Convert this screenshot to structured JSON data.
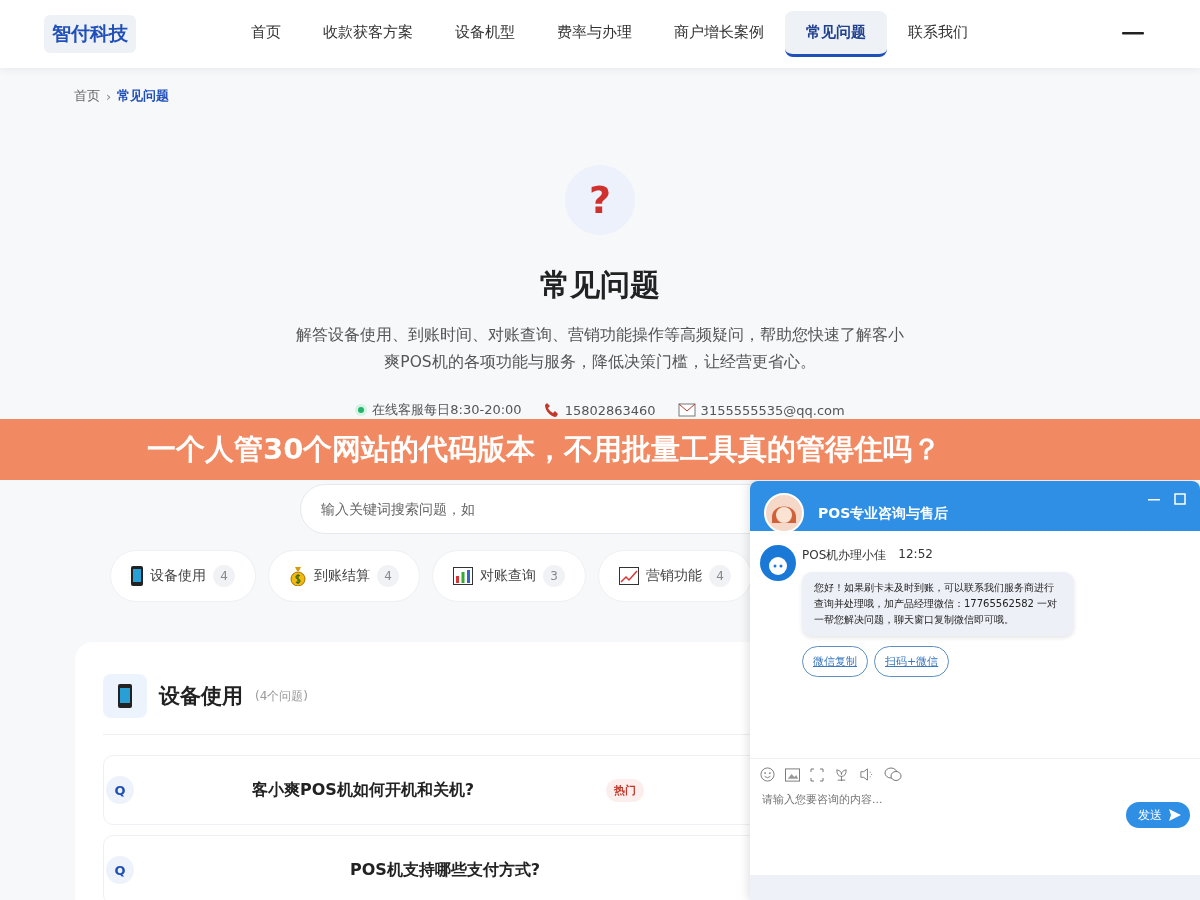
{
  "header": {
    "logo": "智付科技",
    "nav": [
      {
        "label": "首页",
        "selected": false
      },
      {
        "label": "收款获客方案",
        "selected": false
      },
      {
        "label": "设备机型",
        "selected": false
      },
      {
        "label": "费率与办理",
        "selected": false
      },
      {
        "label": "商户增长案例",
        "selected": false
      },
      {
        "label": "常见问题",
        "selected": true
      },
      {
        "label": "联系我们",
        "selected": false
      }
    ]
  },
  "breadcrumb_separator": "›",
  "breadcrumb": [
    {
      "label": "首页",
      "selected": false
    },
    {
      "label": "常见问题",
      "selected": true
    }
  ],
  "hero": {
    "icon": "?",
    "title": "常见问题",
    "description": "解答设备使用、到账时间、对账查询、营销功能操作等高频疑问，帮助您快速了解客小爽POS机的各项功能与服务，降低决策门槛，让经营更省心。",
    "contacts": [
      {
        "kind": "online",
        "text": "在线客服每日8:30-20:00"
      },
      {
        "kind": "phone",
        "text": "15802863460"
      },
      {
        "kind": "mail",
        "text": "3155555535@qq.com"
      }
    ],
    "search": {
      "placeholder": "输入关键词搜索问题，如"
    }
  },
  "categories": [
    {
      "kind": "phone",
      "label": "设备使用",
      "count": "4"
    },
    {
      "kind": "money",
      "label": "到账结算",
      "count": "4"
    },
    {
      "kind": "bars",
      "label": "对账查询",
      "count": "3"
    },
    {
      "kind": "trend",
      "label": "营销功能",
      "count": "4"
    }
  ],
  "section": {
    "title": "设备使用",
    "count": "(4个问题)",
    "questions": [
      {
        "mark": "Q",
        "text": "客小爽POS机如何开机和关机?",
        "hot": true,
        "tag": "热门"
      },
      {
        "mark": "Q",
        "text": "POS机支持哪些支付方式?",
        "hot": false
      }
    ]
  },
  "banner": {
    "text": "一个人管30个网站的代码版本，不用批量工具真的管得住吗？"
  },
  "chat": {
    "title": "POS专业咨询与售后",
    "messages": [
      {
        "sender": "POS机办理小佳",
        "time": "12:52",
        "text": "您好！如果刷卡未及时到账，可以联系我们服务商进行查询并处理哦，加产品经理微信：17765562582 一对一帮您解决问题，聊天窗口复制微信即可哦。"
      }
    ],
    "actions": [
      "微信复制",
      "扫码+微信"
    ],
    "placeholder": "请输入您要咨询的内容...",
    "send": "发送"
  }
}
